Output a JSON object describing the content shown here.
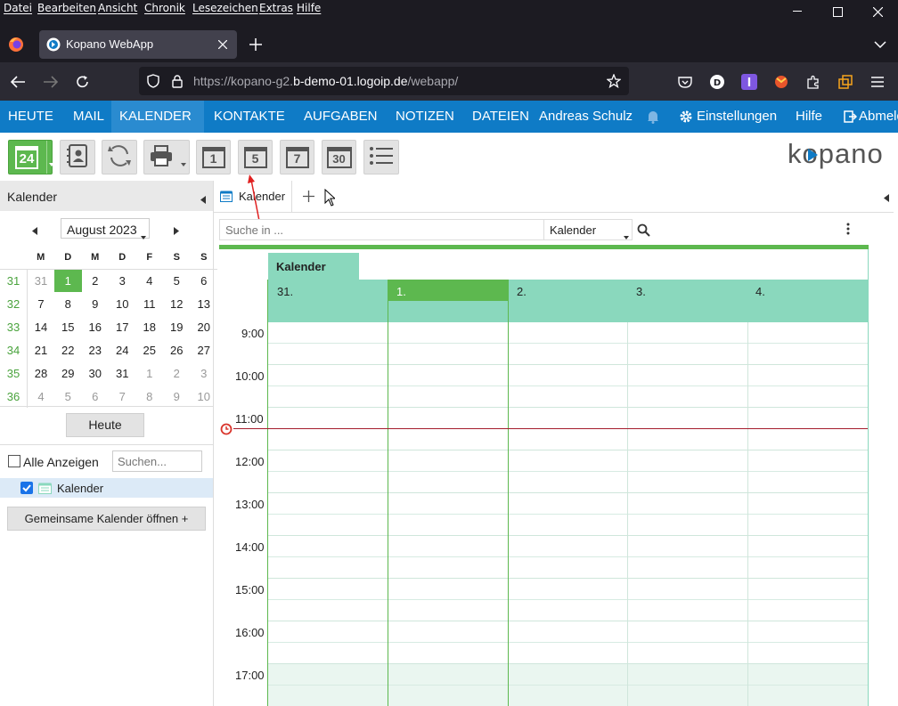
{
  "browser": {
    "menu": [
      "Datei",
      "Bearbeiten",
      "Ansicht",
      "Chronik",
      "Lesezeichen",
      "Extras",
      "Hilfe"
    ],
    "tab_title": "Kopano WebApp",
    "url_prefix": "https://kopano-g2.",
    "url_domain": "b-demo-01.logoip.de",
    "url_path": "/webapp/"
  },
  "appnav": {
    "items": [
      "HEUTE",
      "MAIL",
      "KALENDER",
      "KONTAKTE",
      "AUFGABEN",
      "NOTIZEN",
      "DATEIEN"
    ],
    "user": "Andreas Schulz",
    "settings": "Einstellungen",
    "help": "Hilfe",
    "logout": "Abmelden"
  },
  "toolbar": {
    "new_day": "24",
    "day_view": "1",
    "workweek_view": "5",
    "week_view": "7",
    "month_view": "30",
    "brand": "kopano"
  },
  "sidebar": {
    "title": "Kalender",
    "month_label": "August 2023",
    "weekday_headers": [
      "M",
      "D",
      "M",
      "D",
      "F",
      "S",
      "S"
    ],
    "weeks": [
      {
        "kw": "31",
        "days": [
          "31",
          "1",
          "2",
          "3",
          "4",
          "5",
          "6"
        ]
      },
      {
        "kw": "32",
        "days": [
          "7",
          "8",
          "9",
          "10",
          "11",
          "12",
          "13"
        ]
      },
      {
        "kw": "33",
        "days": [
          "14",
          "15",
          "16",
          "17",
          "18",
          "19",
          "20"
        ]
      },
      {
        "kw": "34",
        "days": [
          "21",
          "22",
          "23",
          "24",
          "25",
          "26",
          "27"
        ]
      },
      {
        "kw": "35",
        "days": [
          "28",
          "29",
          "30",
          "31",
          "1",
          "2",
          "3"
        ]
      },
      {
        "kw": "36",
        "days": [
          "4",
          "5",
          "6",
          "7",
          "8",
          "9",
          "10"
        ]
      }
    ],
    "today_button": "Heute",
    "show_all": "Alle Anzeigen",
    "search_placeholder": "Suchen...",
    "calendar_item": "Kalender",
    "shared_button": "Gemeinsame Kalender öffnen +"
  },
  "content": {
    "tab_label": "Kalender",
    "search_placeholder": "Suche in ...",
    "search_scope": "Kalender",
    "calendar_name": "Kalender",
    "day_headers": [
      "31.",
      "1.",
      "2.",
      "3.",
      "4."
    ],
    "hours": [
      "9:00",
      "10:00",
      "11:00",
      "12:00",
      "13:00",
      "14:00",
      "15:00",
      "16:00",
      "17:00"
    ]
  },
  "colors": {
    "accent_blue": "#0f7bc6",
    "calendar_green": "#5db84f",
    "header_teal": "#8ad8bd",
    "now_line": "#a51d2d"
  }
}
